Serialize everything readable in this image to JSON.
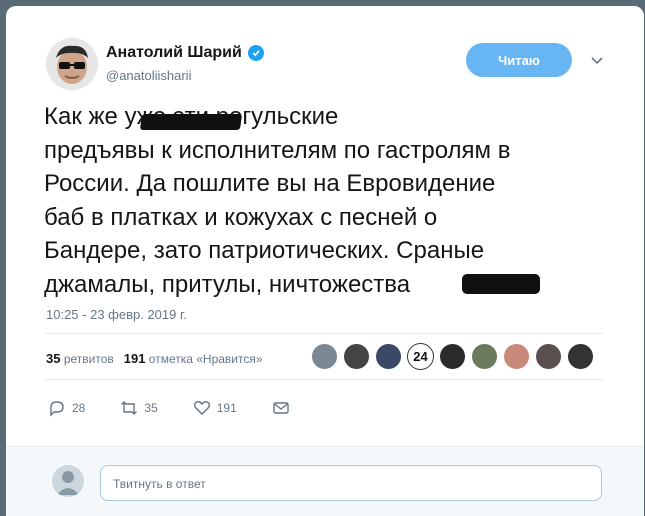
{
  "tweet": {
    "author_name": "Анатолий Шарий",
    "handle": "@anatoliisharii",
    "follow_label": "Читаю",
    "text": "Как же              уже эти рогульские\nпредъявы к исполнителям по гастролям в\nРоссии. Да пошлите вы на Евровидение\nбаб в платках и кожухах с песней о\nБандере, зато патриотических. Сраные\nджамалы, притулы, ничтожества",
    "timestamp": "10:25 - 23 февр. 2019 г."
  },
  "stats": {
    "retweets_count": "35",
    "retweets_label": "ретвитов",
    "likes_count": "191",
    "likes_label": "отметка «Нравится»",
    "liker_badge": "24"
  },
  "actions": {
    "replies": "28",
    "retweets": "35",
    "likes": "191"
  },
  "reply": {
    "placeholder": "Твитнуть в ответ"
  },
  "colors": {
    "accent": "#1da1f2",
    "follow_button": "#67b5f2"
  }
}
